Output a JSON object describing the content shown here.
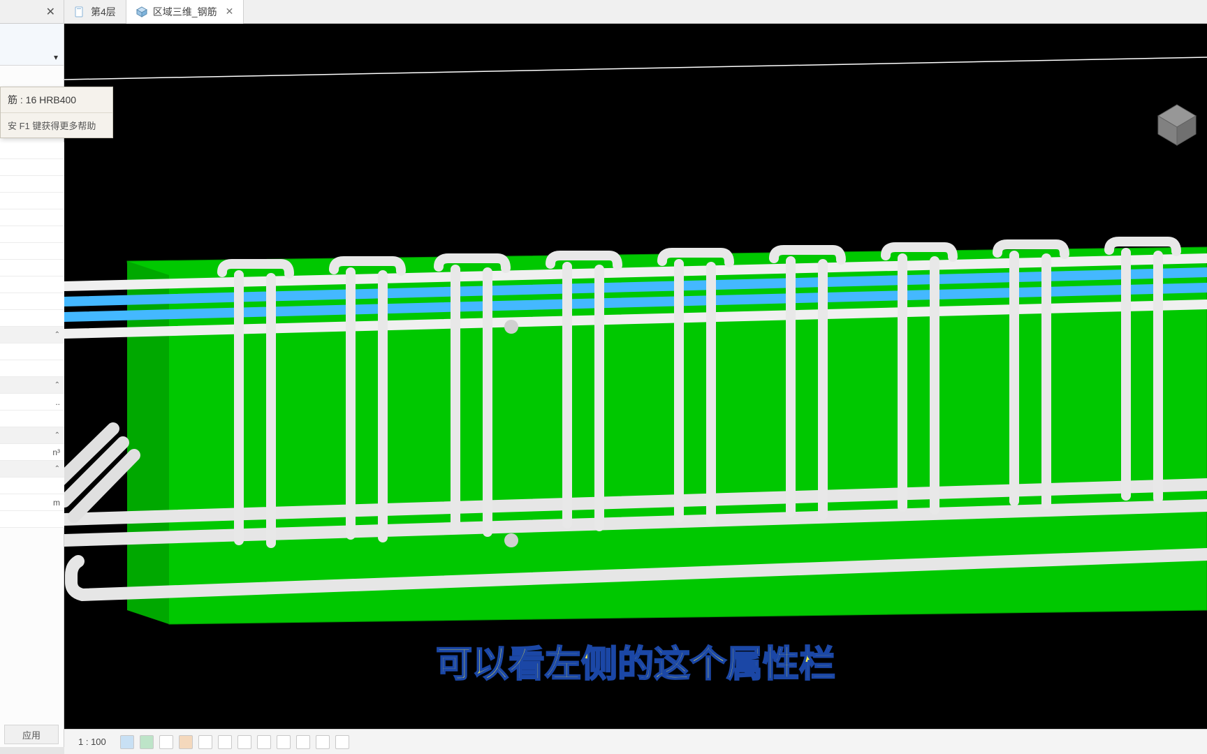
{
  "tabs": {
    "side_close": "✕",
    "tab1": {
      "label": "第4层"
    },
    "tab2": {
      "label": "区域三维_钢筋",
      "close": "✕"
    }
  },
  "dropdown": {
    "caret": "▾"
  },
  "tooltip": {
    "title": "筋 : 16 HRB400",
    "help": "安 F1 键获得更多帮助"
  },
  "rows": {
    "hdr1": "⌃",
    "hdr2": "⌃",
    "val1": "..",
    "hdr3": "⌃",
    "val2": "n³",
    "hdr4": "⌃",
    "val3": "",
    "val4": "m"
  },
  "apply_label": "应用",
  "subtitle": "可以看左侧的这个属性栏",
  "statusbar": {
    "scale": "1 : 100"
  }
}
